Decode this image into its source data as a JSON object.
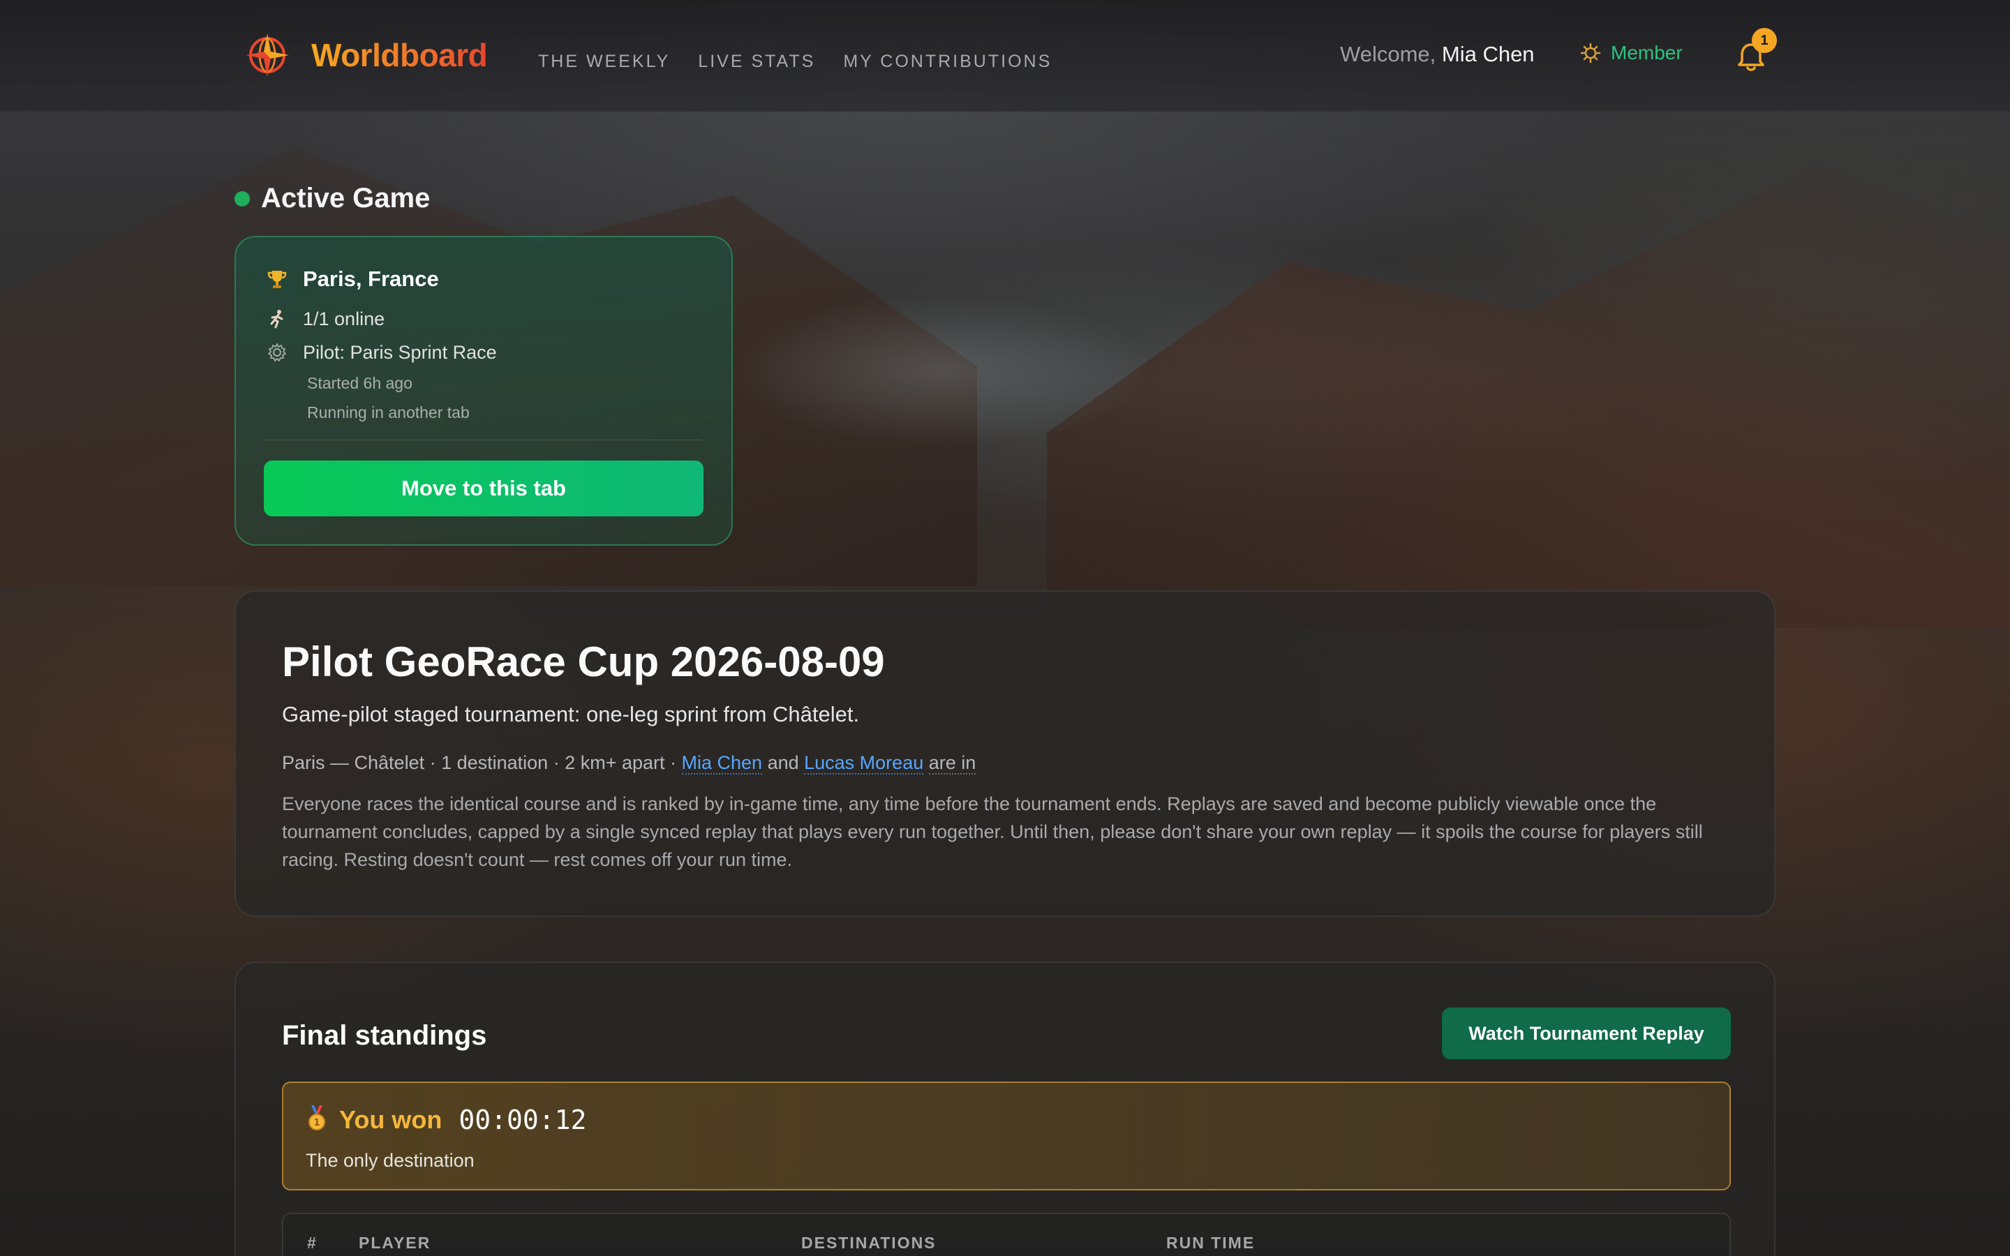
{
  "app": {
    "brand": "Worldboard",
    "accent": "#f0792a"
  },
  "nav": [
    {
      "label": "THE WEEKLY"
    },
    {
      "label": "LIVE STATS"
    },
    {
      "label": "MY CONTRIBUTIONS"
    }
  ],
  "user": {
    "welcome_prefix": "Welcome,",
    "name": "Mia Chen",
    "tier": "Member",
    "notifications": "1"
  },
  "active_game": {
    "heading": "Active Game",
    "status_color": "#1fae5b",
    "location": "Paris, France",
    "online": "1/1 online",
    "pilot": "Pilot: Paris Sprint Race",
    "started": "Started 6h ago",
    "running": "Running in another tab",
    "move_button": "Move to this tab"
  },
  "tournament": {
    "title": "Pilot GeoRace Cup 2026-08-09",
    "subtitle": "Game-pilot staged tournament: one-leg sprint from Châtelet.",
    "meta_prefix": "Paris — Châtelet · 1 destination · 2 km+ apart · ",
    "player1": "Mia Chen",
    "and": " and ",
    "player2": "Lucas Moreau",
    "meta_suffix": "are in",
    "description": "Everyone races the identical course and is ranked by in-game time, any time before the tournament ends. Replays are saved and become publicly viewable once the tournament concludes, capped by a single synced replay that plays every run together. Until then, please don't share your own replay — it spoils the course for players still racing. Resting doesn't count — rest comes off your run time."
  },
  "standings": {
    "title": "Final standings",
    "replay_button": "Watch Tournament Replay",
    "won_label": "You won",
    "won_time": "00:00:12",
    "won_sub": "The only destination",
    "columns": [
      "#",
      "PLAYER",
      "DESTINATIONS",
      "RUN TIME"
    ]
  },
  "icons": {
    "logo": "compass-globe-icon",
    "member": "badge-icon",
    "bell": "bell-icon",
    "trophy": "trophy-icon",
    "runner": "runner-icon",
    "gear": "gear-icon",
    "medal": "medal-icon"
  }
}
